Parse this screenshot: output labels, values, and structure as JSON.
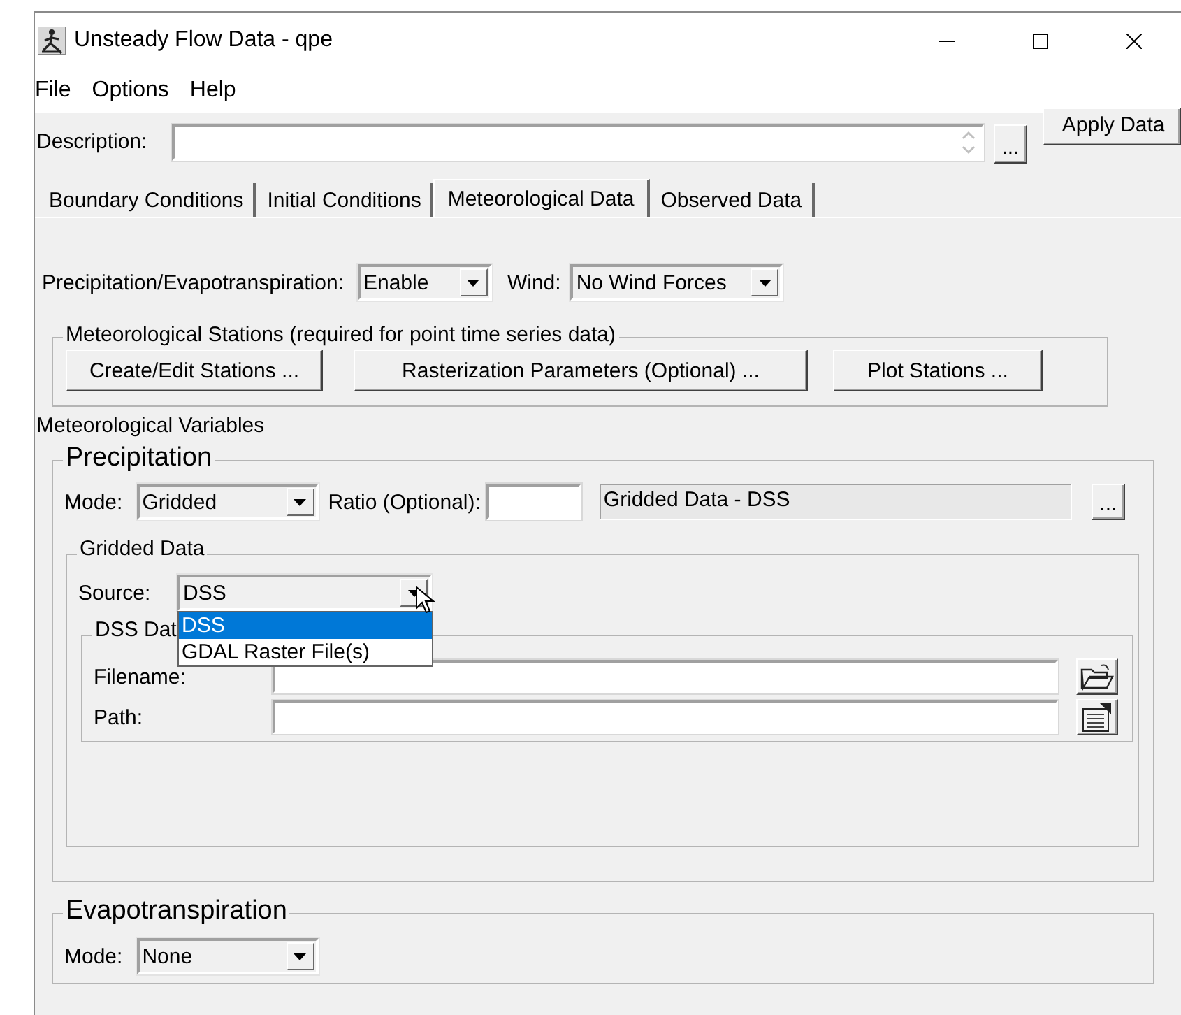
{
  "window": {
    "title": "Unsteady Flow Data - qpe"
  },
  "menu": [
    "File",
    "Options",
    "Help"
  ],
  "description": {
    "label": "Description:",
    "more_button": "...",
    "apply_button": "Apply Data"
  },
  "tabs": [
    {
      "label": "Boundary Conditions",
      "selected": false
    },
    {
      "label": "Initial Conditions",
      "selected": false
    },
    {
      "label": "Meteorological Data",
      "selected": true
    },
    {
      "label": "Observed Data",
      "selected": false
    }
  ],
  "precip_evap": {
    "label": "Precipitation/Evapotranspiration:",
    "value": "Enable"
  },
  "wind": {
    "label": "Wind:",
    "value": "No Wind Forces"
  },
  "stations": {
    "title": "Meteorological Stations (required for point time series data)",
    "buttons": [
      "Create/Edit Stations ...",
      "Rasterization Parameters (Optional) ...",
      "Plot Stations ..."
    ]
  },
  "variables_label": "Meteorological Variables",
  "precipitation": {
    "title": "Precipitation",
    "mode_label": "Mode:",
    "mode": "Gridded",
    "ratio_label": "Ratio (Optional):",
    "summary": "Gridded Data - DSS",
    "more_button": "...",
    "gridded": {
      "title": "Gridded Data",
      "source_label": "Source:",
      "source": "DSS",
      "options": [
        {
          "label": "DSS",
          "selected": true
        },
        {
          "label": "GDAL Raster File(s)",
          "selected": false
        }
      ],
      "dss": {
        "title": "DSS Dat",
        "fields": [
          {
            "label": "Filename:",
            "kind": "open"
          },
          {
            "label": "Path:",
            "kind": "select"
          }
        ]
      }
    }
  },
  "evapotranspiration": {
    "title": "Evapotranspiration",
    "mode_label": "Mode:",
    "mode": "None"
  }
}
